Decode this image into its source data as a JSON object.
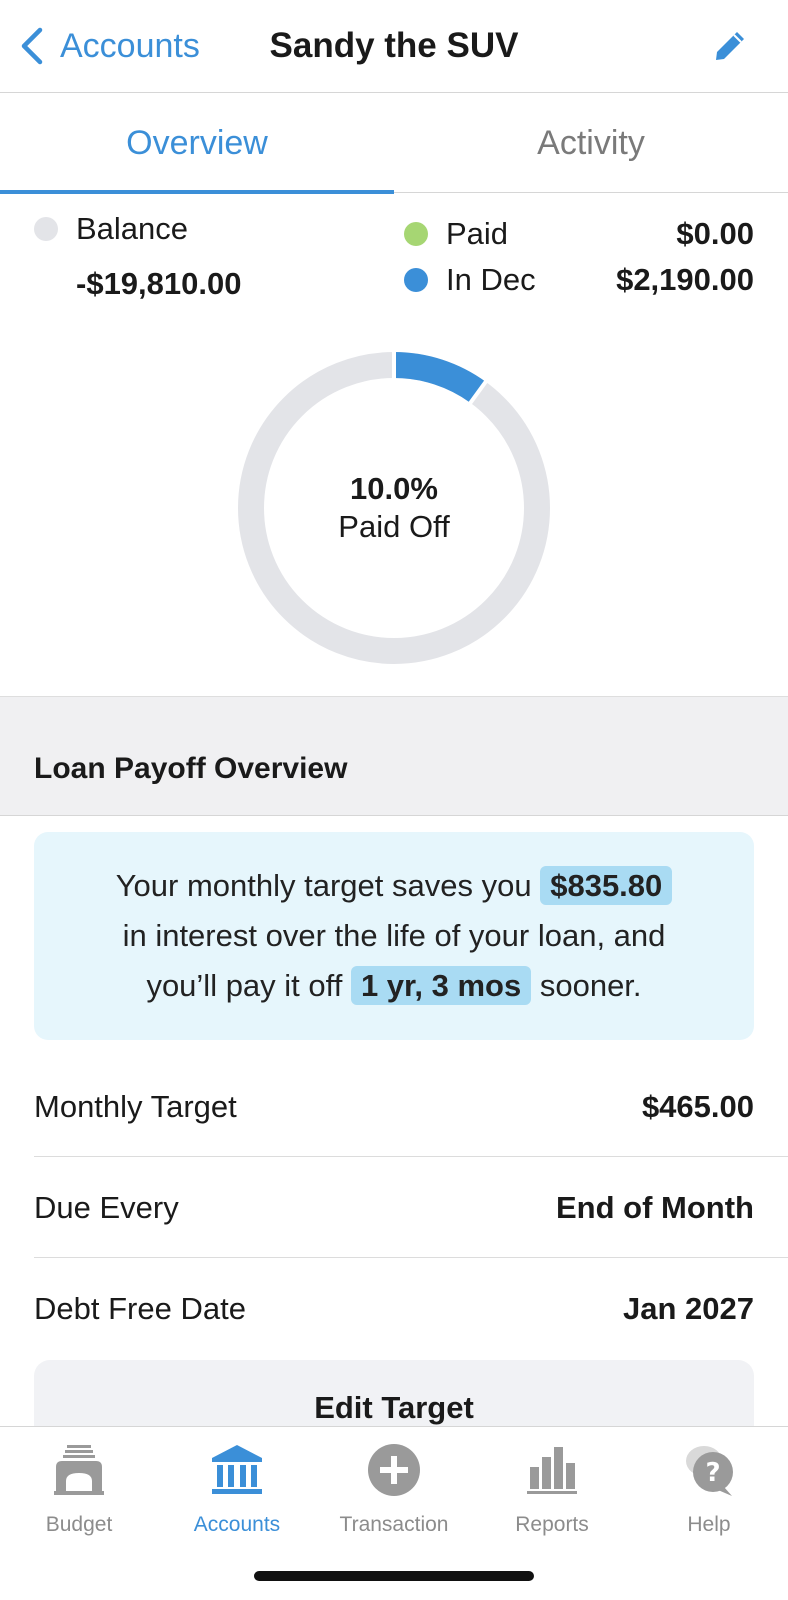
{
  "header": {
    "back_label": "Accounts",
    "title": "Sandy the SUV"
  },
  "tabs": [
    {
      "label": "Overview",
      "active": true
    },
    {
      "label": "Activity",
      "active": false
    }
  ],
  "summary": {
    "balance_label": "Balance",
    "balance_value": "-$19,810.00",
    "paid_label": "Paid",
    "paid_value": "$0.00",
    "in_month_label": "In Dec",
    "in_month_value": "$2,190.00",
    "percent": "10.0%",
    "percent_label": "Paid Off",
    "paid_fraction": 0.1
  },
  "colors": {
    "accent": "#3b8fd8",
    "paid_dot": "#a6d673",
    "balance_dot": "#e3e4e8",
    "donut_track": "#e3e4e8"
  },
  "loan": {
    "section_title": "Loan Payoff Overview",
    "info_part1": "Your monthly target saves you",
    "info_amount": "$835.80",
    "info_part2": "in interest over the life of your loan, and",
    "info_part3": "you’ll pay it off",
    "info_time": "1 yr, 3 mos",
    "info_part4": "sooner.",
    "rows": [
      {
        "label": "Monthly Target",
        "value": "$465.00"
      },
      {
        "label": "Due Every",
        "value": "End of Month"
      },
      {
        "label": "Debt Free Date",
        "value": "Jan 2027"
      }
    ],
    "edit_button": "Edit Target"
  },
  "nav": [
    {
      "label": "Budget",
      "icon": "budget-icon",
      "active": false
    },
    {
      "label": "Accounts",
      "icon": "bank-icon",
      "active": true
    },
    {
      "label": "Transaction",
      "icon": "plus-circle-icon",
      "active": false
    },
    {
      "label": "Reports",
      "icon": "bar-chart-icon",
      "active": false
    },
    {
      "label": "Help",
      "icon": "help-bubble-icon",
      "active": false
    }
  ]
}
